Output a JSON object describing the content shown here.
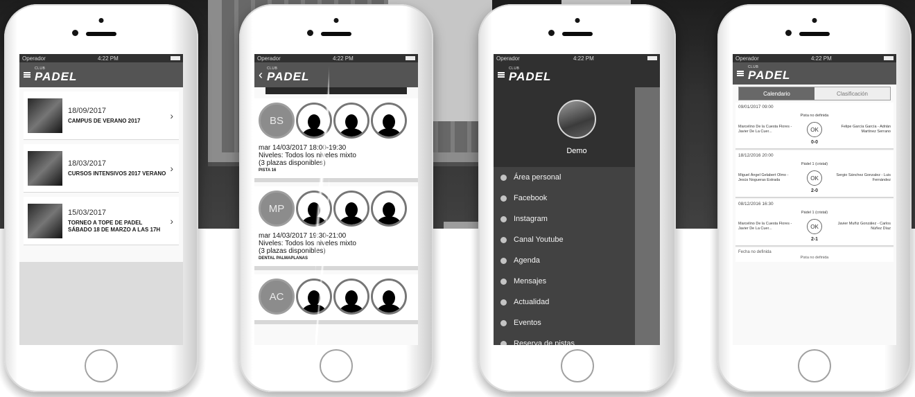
{
  "status": {
    "carrier": "Operador",
    "time": "4:22 PM"
  },
  "brand": {
    "small": "CLUB",
    "big": "PADEL"
  },
  "phone1": {
    "items": [
      {
        "date": "18/09/2017",
        "title": "CAMPUS DE VERANO 2017"
      },
      {
        "date": "18/03/2017",
        "title": "CURSOS INTENSIVOS 2017 VERANO"
      },
      {
        "date": "15/03/2017",
        "title": "TORNEO A TOPE DE PADEL SÁBADO 18 DE MARZO A LAS 17H"
      }
    ]
  },
  "phone2": {
    "bookings": [
      {
        "initials": "BS",
        "date": "mar 14/03/2017 18:00-19:30",
        "level": "Niveles: Todos los niveles mixto",
        "avail": "(3 plazas disponibles)",
        "court": "PISTA 16"
      },
      {
        "initials": "MP",
        "date": "mar 14/03/2017 19:30-21:00",
        "level": "Niveles: Todos los niveles mixto",
        "avail": "(3 plazas disponibles)",
        "court": "DENTAL PALMAPLANAS"
      },
      {
        "initials": "AC"
      }
    ]
  },
  "phone3": {
    "name": "Demo",
    "menu": [
      "Área personal",
      "Facebook",
      "Instagram",
      "Canal Youtube",
      "Agenda",
      "Mensajes",
      "Actualidad",
      "Eventos",
      "Reserva de pistas"
    ]
  },
  "phone4": {
    "tabs": [
      "Calendario",
      "Clasificación"
    ],
    "matches": [
      {
        "date": "09/01/2017 09:00",
        "court": "Pista no definida",
        "teamA": "Marcelino De la Cuesta Flores - Javier De La Cuer...",
        "teamB": "Felipe García García - Adrián Martínez Serrano",
        "ok": "OK",
        "score": "0-0"
      },
      {
        "date": "18/12/2016 20:00",
        "court": "Pádel 1 (cristal)",
        "teamA": "Miguel Ángel Gelabert Olmo - Jesús Nogueras Estrada",
        "teamB": "Sergio Sánchez Gonzalez - Luis Fernández",
        "ok": "OK",
        "score": "2-0"
      },
      {
        "date": "08/12/2016 16:30",
        "court": "Pádel 1 (cristal)",
        "teamA": "Marcelino De la Cuesta Flores - Javier De La Cuer...",
        "teamB": "Javier Muñiz González - Carlos Núñez Díaz",
        "ok": "OK",
        "score": "2-1"
      }
    ],
    "unset": {
      "date": "Fecha no definida",
      "court": "Pista no definida"
    }
  }
}
